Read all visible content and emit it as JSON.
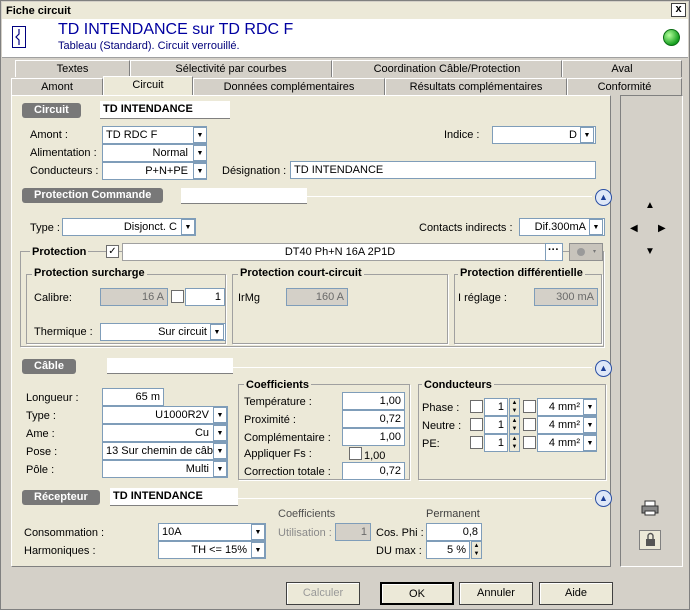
{
  "window": {
    "title": "Fiche circuit",
    "close": "x"
  },
  "header": {
    "title": "TD INTENDANCE sur TD RDC F",
    "subtitle": "Tableau (Standard).  Circuit verrouillé.",
    "status_color": "#16a020"
  },
  "tabs_row1": [
    "Textes",
    "Sélectivité par courbes",
    "Coordination Câble/Protection",
    "Aval"
  ],
  "tabs_row2": [
    "Amont",
    "Circuit",
    "Données complémentaires",
    "Résultats complémentaires",
    "Conformité"
  ],
  "circuit": {
    "section": "Circuit",
    "name": "TD INTENDANCE",
    "amont_label": "Amont :",
    "amont": "TD RDC F",
    "alim_label": "Alimentation :",
    "alim": "Normal",
    "cond_label": "Conducteurs :",
    "cond": "P+N+PE",
    "indice_label": "Indice :",
    "indice": "D",
    "desig_label": "Désignation :",
    "desig": "TD INTENDANCE"
  },
  "protcmd": {
    "section": "Protection Commande",
    "type_label": "Type :",
    "type": "Disjonct. C",
    "contacts_label": "Contacts indirects :",
    "contacts": "Dif.300mA"
  },
  "protection": {
    "label": "Protection",
    "device": "DT40 Ph+N   16A 2P1D",
    "more": "···",
    "surcharge": {
      "title": "Protection surcharge",
      "calibre_label": "Calibre:",
      "calibre": "16 A",
      "calibre2": "1",
      "thermique_label": "Thermique :",
      "thermique": "Sur circuit"
    },
    "cc": {
      "title": "Protection court-circuit",
      "irmg_label": "IrMg",
      "irmg": "160 A"
    },
    "diff": {
      "title": "Protection différentielle",
      "ireg_label": "I réglage :",
      "ireg": "300 mA"
    }
  },
  "cable": {
    "section": "Câble",
    "longueur_label": "Longueur :",
    "longueur": "65 m",
    "type_label": "Type :",
    "type": "U1000R2V",
    "ame_label": "Ame :",
    "ame": "Cu",
    "pose_label": "Pose :",
    "pose": "13  Sur chemin de câb",
    "pole_label": "Pôle :",
    "pole": "Multi",
    "coef": {
      "title": "Coefficients",
      "temp_label": "Température :",
      "temp": "1,00",
      "prox_label": "Proximité :",
      "prox": "0,72",
      "comp_label": "Complémentaire :",
      "comp": "1,00",
      "fs_label": "Appliquer Fs :",
      "fs": "1,00",
      "total_label": "Correction totale :",
      "total": "0,72"
    },
    "cond": {
      "title": "Conducteurs",
      "phase_label": "Phase :",
      "phase_n": "1",
      "phase_s": "4 mm²",
      "neutre_label": "Neutre :",
      "neutre_n": "1",
      "neutre_s": "4 mm²",
      "pe_label": "PE:",
      "pe_n": "1",
      "pe_s": "4 mm²"
    }
  },
  "recepteur": {
    "section": "Récepteur",
    "name": "TD INTENDANCE",
    "conso_label": "Consommation :",
    "conso": "10A",
    "harm_label": "Harmoniques :",
    "harm": "TH <= 15%",
    "coef_title": "Coefficients",
    "util_label": "Utilisation :",
    "util": "1",
    "perm_title": "Permanent",
    "cosphi_label": "Cos. Phi :",
    "cosphi": "0,8",
    "du_label": "DU max :",
    "du": "5 %"
  },
  "buttons": {
    "calculer": "Calculer",
    "ok": "OK",
    "annuler": "Annuler",
    "aide": "Aide"
  }
}
